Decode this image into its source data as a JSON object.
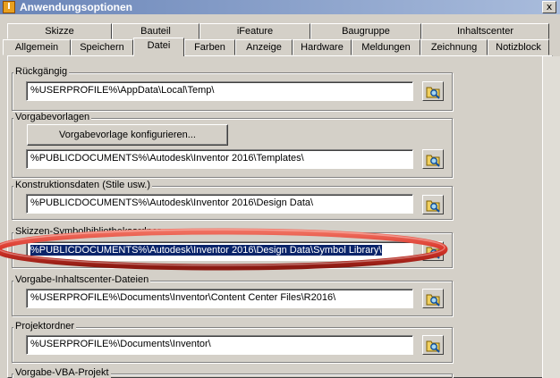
{
  "window": {
    "title": "Anwendungsoptionen",
    "app_icon_letter": "I",
    "close_glyph": "x"
  },
  "tabs_back": [
    "Skizze",
    "Bauteil",
    "iFeature",
    "Baugruppe",
    "Inhaltscenter"
  ],
  "tabs_front": [
    "Allgemein",
    "Speichern",
    "Datei",
    "Farben",
    "Anzeige",
    "Hardware",
    "Meldungen",
    "Zeichnung",
    "Notizblock"
  ],
  "active_tab": "Datei",
  "groups": {
    "undo": {
      "label": "Rückgängig",
      "path": "%USERPROFILE%\\AppData\\Local\\Temp\\"
    },
    "templates": {
      "label": "Vorgabevorlagen",
      "button": "Vorgabevorlage konfigurieren...",
      "path": "%PUBLICDOCUMENTS%\\Autodesk\\Inventor 2016\\Templates\\"
    },
    "design_data": {
      "label": "Konstruktionsdaten (Stile usw.)",
      "path": "%PUBLICDOCUMENTS%\\Autodesk\\Inventor 2016\\Design Data\\"
    },
    "symbol_library": {
      "label": "Skizzen-Symbolbibliotheksordner",
      "path": "%PUBLICDOCUMENTS%\\Autodesk\\Inventor 2016\\Design Data\\Symbol Library\\"
    },
    "content_center": {
      "label": "Vorgabe-Inhaltscenter-Dateien",
      "path": "%USERPROFILE%\\Documents\\Inventor\\Content Center Files\\R2016\\"
    },
    "project": {
      "label": "Projektordner",
      "path": "%USERPROFILE%\\Documents\\Inventor\\"
    },
    "vba": {
      "label": "Vorgabe-VBA-Projekt"
    }
  },
  "colors": {
    "selection": "#0a246a",
    "highlight_oval": "#d9352a",
    "title_gradient_start": "#6a85b8"
  },
  "icons": {
    "browse": "folder-search-icon"
  }
}
